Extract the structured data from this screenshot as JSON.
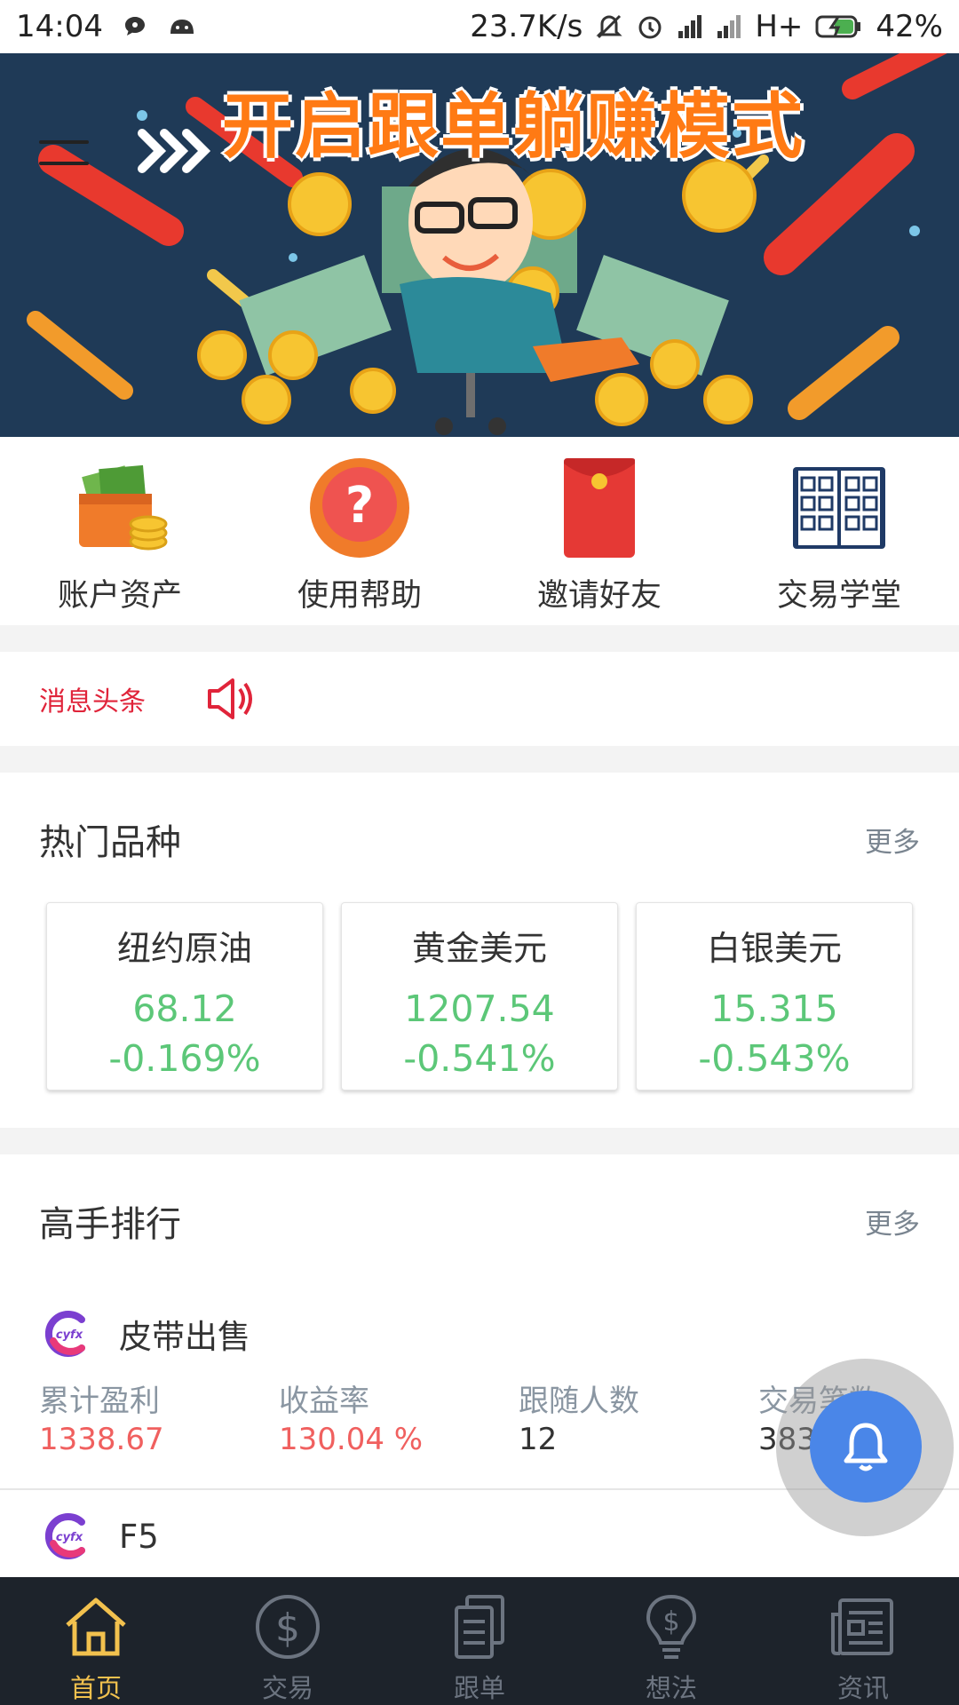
{
  "status_bar": {
    "time": "14:04",
    "net_speed": "23.7K/s",
    "network": "H+",
    "battery": "42%"
  },
  "banner": {
    "title": "开启跟单躺赚模式",
    "colors": {
      "background": "#1f3a57",
      "title": "#ff7a14"
    }
  },
  "quick_nav": [
    {
      "label": "账户资产",
      "icon": "wallet-icon"
    },
    {
      "label": "使用帮助",
      "icon": "help-icon"
    },
    {
      "label": "邀请好友",
      "icon": "red-envelope-icon"
    },
    {
      "label": "交易学堂",
      "icon": "book-icon"
    }
  ],
  "news": {
    "label": "消息头条",
    "icon": "speaker-icon"
  },
  "hot_products": {
    "title": "热门品种",
    "more": "更多",
    "items": [
      {
        "name": "纽约原油",
        "price": "68.12",
        "change": "-0.169%"
      },
      {
        "name": "黄金美元",
        "price": "1207.54",
        "change": "-0.541%"
      },
      {
        "name": "白银美元",
        "price": "15.315",
        "change": "-0.543%"
      }
    ]
  },
  "rankings": {
    "title": "高手排行",
    "more": "更多",
    "traders": [
      {
        "name": "皮带出售",
        "logo_text": "cyfx",
        "stats": [
          {
            "label": "累计盈利",
            "value": "1338.67"
          },
          {
            "label": "收益率",
            "value": "130.04 %"
          },
          {
            "label": "跟随人数",
            "value": "12"
          },
          {
            "label": "交易笔数",
            "value": "383"
          }
        ]
      },
      {
        "name": "F5",
        "logo_text": "cyfx"
      }
    ]
  },
  "fab": {
    "icon": "bell-icon",
    "color": "#4a86e8"
  },
  "tab_bar": [
    {
      "label": "首页",
      "icon": "home-icon",
      "active": true
    },
    {
      "label": "交易",
      "icon": "dollar-icon",
      "active": false
    },
    {
      "label": "跟单",
      "icon": "document-icon",
      "active": false
    },
    {
      "label": "想法",
      "icon": "lightbulb-icon",
      "active": false
    },
    {
      "label": "资讯",
      "icon": "news-icon",
      "active": false
    }
  ],
  "colors": {
    "up": "#5cc778",
    "profit": "#f0605f",
    "accent": "#e0243a",
    "tab_active": "#f2c14e"
  }
}
